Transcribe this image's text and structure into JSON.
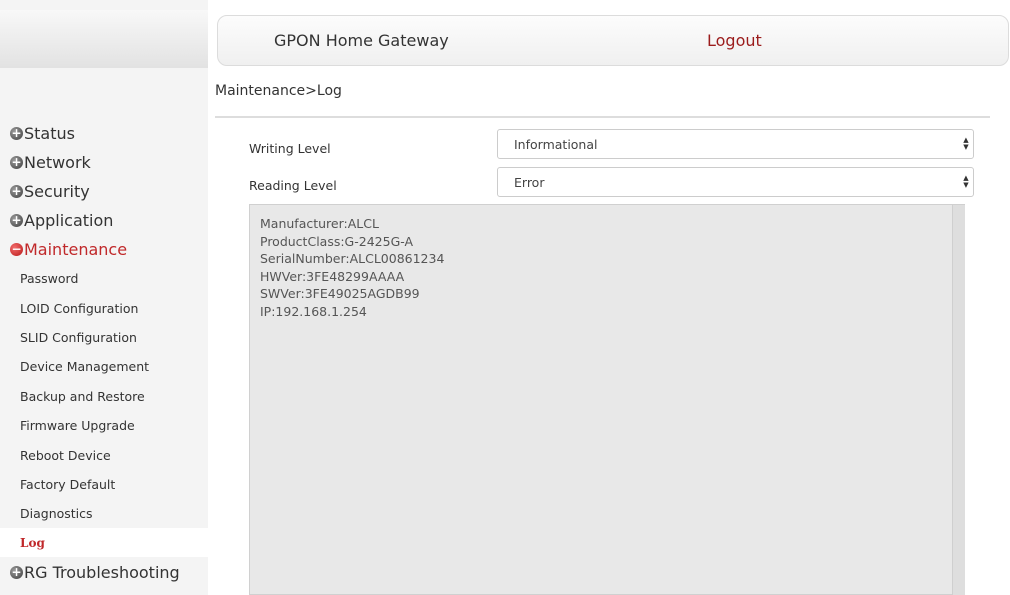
{
  "header": {
    "title": "GPON Home Gateway",
    "logout_label": "Logout"
  },
  "breadcrumb": "Maintenance>Log",
  "sidebar": {
    "main_menu": [
      {
        "label": "Status",
        "expanded": false
      },
      {
        "label": "Network",
        "expanded": false
      },
      {
        "label": "Security",
        "expanded": false
      },
      {
        "label": "Application",
        "expanded": false
      },
      {
        "label": "Maintenance",
        "expanded": true
      },
      {
        "label": "RG Troubleshooting",
        "expanded": false
      }
    ],
    "maintenance_items": [
      "Password",
      "LOID Configuration",
      "SLID Configuration",
      "Device Management",
      "Backup and Restore",
      "Firmware Upgrade",
      "Reboot Device",
      "Factory Default",
      "Diagnostics",
      "Log"
    ],
    "selected_item": "Log"
  },
  "form": {
    "writing_level": {
      "label": "Writing Level",
      "value": "Informational"
    },
    "reading_level": {
      "label": "Reading Level",
      "value": "Error"
    }
  },
  "log_lines": [
    "Manufacturer:ALCL",
    "ProductClass:G-2425G-A",
    "SerialNumber:ALCL00861234",
    "HWVer:3FE48299AAAA",
    "SWVer:3FE49025AGDB99",
    "IP:192.168.1.254"
  ],
  "colors": {
    "accent_red": "#c0282a",
    "logout_red": "#9b1c1c",
    "log_bg": "#e8e8e8"
  }
}
